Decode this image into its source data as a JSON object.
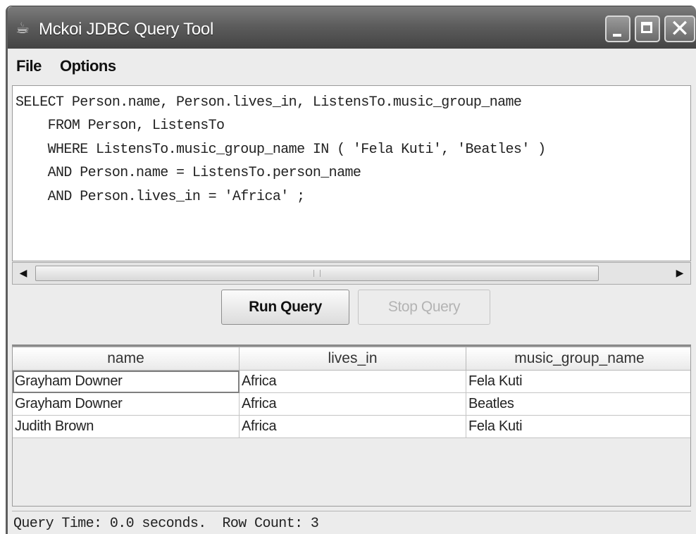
{
  "window": {
    "title": "Mckoi JDBC Query Tool",
    "app_icon": "java-cup-icon"
  },
  "menu": [
    "File",
    "Options"
  ],
  "editor": {
    "sql_lines": [
      "SELECT Person.name, Person.lives_in, ListensTo.music_group_name",
      "    FROM Person, ListensTo",
      "    WHERE ListensTo.music_group_name IN ( 'Fela Kuti', 'Beatles' )",
      "    AND Person.name = ListensTo.person_name",
      "    AND Person.lives_in = 'Africa' ;"
    ]
  },
  "buttons": {
    "run": "Run Query",
    "stop": "Stop Query"
  },
  "results": {
    "columns": [
      "name",
      "lives_in",
      "music_group_name"
    ],
    "rows": [
      [
        "Grayham Downer",
        "Africa",
        "Fela Kuti"
      ],
      [
        "Grayham Downer",
        "Africa",
        "Beatles"
      ],
      [
        "Judith Brown",
        "Africa",
        "Fela Kuti"
      ]
    ]
  },
  "status": {
    "text": "Query Time: 0.0 seconds.  Row Count: 3"
  }
}
